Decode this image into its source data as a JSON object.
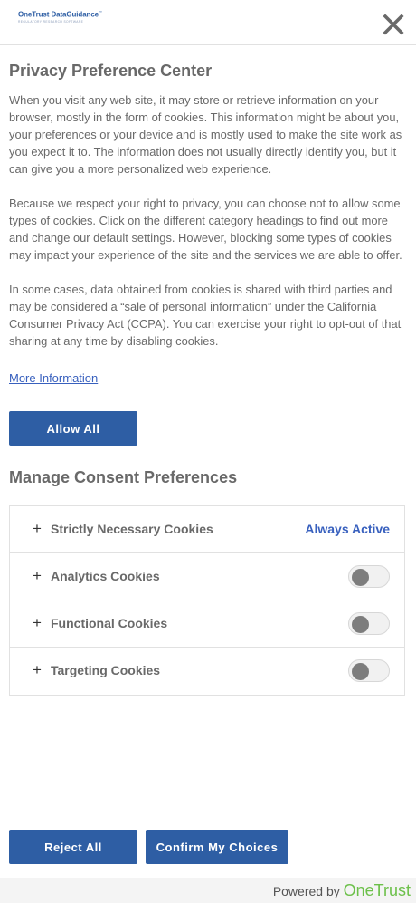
{
  "header": {
    "logo_main": "OneTrust DataGuidance",
    "logo_tm": "™",
    "logo_sub": "Regulatory Research Software"
  },
  "title": "Privacy Preference Center",
  "description": [
    "When you visit any web site, it may store or retrieve information on your browser, mostly in the form of cookies. This information might be about you, your preferences or your device and is mostly used to make the site work as you expect it to. The information does not usually directly identify you, but it can give you a more personalized web experience.",
    "Because we respect your right to privacy, you can choose not to allow some types of cookies. Click on the different category headings to find out more and change our default settings. However, blocking some types of cookies may impact your experience of the site and the services we are able to offer.",
    "In some cases, data obtained from cookies is shared with third parties and may be considered a “sale of personal information” under the California Consumer Privacy Act (CCPA). You can exercise your right to opt-out of that sharing at any time by disabling cookies."
  ],
  "more_info_label": "More Information",
  "allow_all_label": "Allow All",
  "manage_title": "Manage Consent Preferences",
  "categories": [
    {
      "label": "Strictly Necessary Cookies",
      "status": "Always Active"
    },
    {
      "label": "Analytics Cookies",
      "enabled": false
    },
    {
      "label": "Functional Cookies",
      "enabled": false
    },
    {
      "label": "Targeting Cookies",
      "enabled": false
    }
  ],
  "expand_symbol": "+",
  "footer": {
    "reject_all_label": "Reject All",
    "confirm_label": "Confirm My Choices",
    "powered_by": "Powered by",
    "powered_brand": "OneTrust"
  },
  "colors": {
    "button": "#2e5ea4",
    "link": "#3860be",
    "brand_green": "#6cc04a"
  },
  "icons": {
    "close": "close-icon",
    "expand": "plus-icon"
  }
}
